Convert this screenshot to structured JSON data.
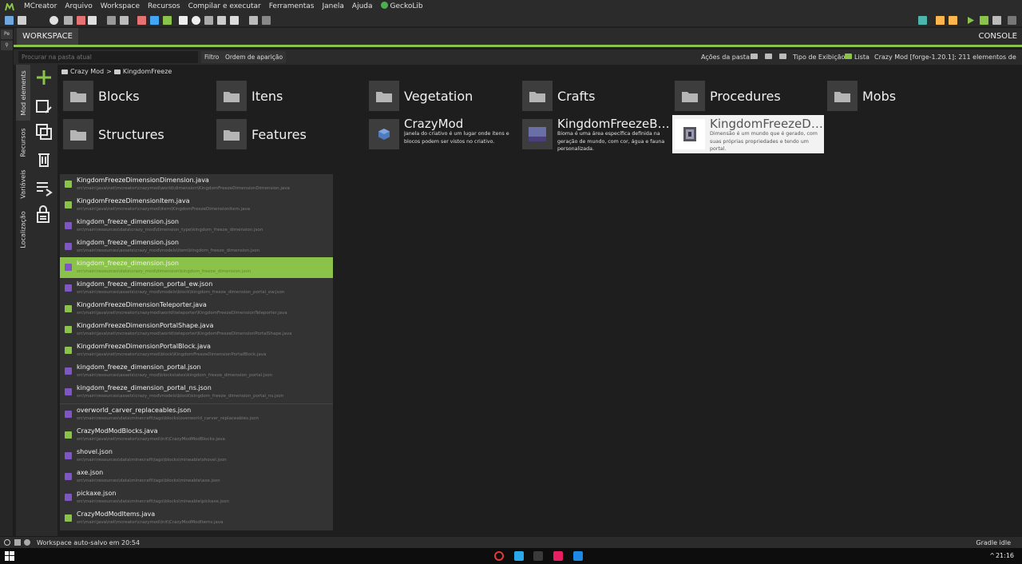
{
  "menubar": {
    "items": [
      "MCreator",
      "Arquivo",
      "Workspace",
      "Recursos",
      "Compilar e executar",
      "Ferramentas",
      "Janela",
      "Ajuda",
      "GeckoLib"
    ]
  },
  "tabs": {
    "workspace": "WORKSPACE",
    "console": "CONSOLE"
  },
  "search": {
    "placeholder": "Procurar na pasta atual",
    "filter_label": "Filtro",
    "order_label": "Ordem de aparição",
    "folder_actions_label": "Ações da pasta:",
    "view_type_label": "Tipo de Exibição:",
    "view_mode": "Lista",
    "workspace_info": "Crazy Mod [forge-1.20.1]: 211 elementos de mod"
  },
  "sidetabs": [
    "Mod elements",
    "Recursos",
    "Variáveis",
    "Localização"
  ],
  "breadcrumb": {
    "root": "Crazy Mod",
    "separator": ">",
    "current": "KingdomFreeze"
  },
  "folders": [
    "Blocks",
    "Itens",
    "Vegetation",
    "Crafts",
    "Procedures",
    "Mobs",
    "Structures",
    "Features"
  ],
  "elements": [
    {
      "title": "CrazyMod",
      "desc": "Janela do criativo é um lugar onde itens e blocos podem ser vistos no criativo."
    },
    {
      "title": "KingdomFreezeBio...",
      "desc": "Bioma é uma área específica definida na geração de mundo, com cor, água e fauna personalizada."
    },
    {
      "title": "KingdomFreezeDi...",
      "desc": "Dimensão é um mundo que é gerado, com suas próprias propriedades e tendo um portal."
    }
  ],
  "files": [
    {
      "name": "KingdomFreezeDimensionDimension.java",
      "path": "src\\main\\java\\net\\mcreator\\crazymod\\world\\dimension\\KingdomFreezeDimensionDimension.java",
      "type": "java"
    },
    {
      "name": "KingdomFreezeDimensionItem.java",
      "path": "src\\main\\java\\net\\mcreator\\crazymod\\item\\KingdomFreezeDimensionItem.java",
      "type": "java"
    },
    {
      "name": "kingdom_freeze_dimension.json",
      "path": "src\\main\\resources\\data\\crazy_mod\\dimension_type\\kingdom_freeze_dimension.json",
      "type": "json"
    },
    {
      "name": "kingdom_freeze_dimension.json",
      "path": "src\\main\\resources\\assets\\crazy_mod\\models\\item\\kingdom_freeze_dimension.json",
      "type": "json"
    },
    {
      "name": "kingdom_freeze_dimension.json",
      "path": "src\\main\\resources\\data\\crazy_mod\\dimension\\kingdom_freeze_dimension.json",
      "type": "json"
    },
    {
      "name": "kingdom_freeze_dimension_portal_ew.json",
      "path": "src\\main\\resources\\assets\\crazy_mod\\models\\block\\kingdom_freeze_dimension_portal_ew.json",
      "type": "json"
    },
    {
      "name": "KingdomFreezeDimensionTeleporter.java",
      "path": "src\\main\\java\\net\\mcreator\\crazymod\\world\\teleporter\\KingdomFreezeDimensionTeleporter.java",
      "type": "java"
    },
    {
      "name": "KingdomFreezeDimensionPortalShape.java",
      "path": "src\\main\\java\\net\\mcreator\\crazymod\\world\\teleporter\\KingdomFreezeDimensionPortalShape.java",
      "type": "java"
    },
    {
      "name": "KingdomFreezeDimensionPortalBlock.java",
      "path": "src\\main\\java\\net\\mcreator\\crazymod\\block\\KingdomFreezeDimensionPortalBlock.java",
      "type": "java"
    },
    {
      "name": "kingdom_freeze_dimension_portal.json",
      "path": "src\\main\\resources\\assets\\crazy_mod\\blockstates\\kingdom_freeze_dimension_portal.json",
      "type": "json"
    },
    {
      "name": "kingdom_freeze_dimension_portal_ns.json",
      "path": "src\\main\\resources\\assets\\crazy_mod\\models\\block\\kingdom_freeze_dimension_portal_ns.json",
      "type": "json"
    },
    {
      "name": "overworld_carver_replaceables.json",
      "path": "src\\main\\resources\\data\\minecraft\\tags\\blocks\\overworld_carver_replaceables.json",
      "type": "json"
    },
    {
      "name": "CrazyModModBlocks.java",
      "path": "src\\main\\java\\net\\mcreator\\crazymod\\init\\CrazyModModBlocks.java",
      "type": "java"
    },
    {
      "name": "shovel.json",
      "path": "src\\main\\resources\\data\\minecraft\\tags\\blocks\\mineable\\shovel.json",
      "type": "json"
    },
    {
      "name": "axe.json",
      "path": "src\\main\\resources\\data\\minecraft\\tags\\blocks\\mineable\\axe.json",
      "type": "json"
    },
    {
      "name": "pickaxe.json",
      "path": "src\\main\\resources\\data\\minecraft\\tags\\blocks\\mineable\\pickaxe.json",
      "type": "json"
    },
    {
      "name": "CrazyModModItems.java",
      "path": "src\\main\\java\\net\\mcreator\\crazymod\\init\\CrazyModModItems.java",
      "type": "java"
    }
  ],
  "status": {
    "text": "Workspace auto-salvo em 20:54",
    "right": "Gradle idle"
  },
  "taskbar": {
    "clock": "21:16"
  },
  "colors": {
    "accent": "#8bc34a",
    "json_icon": "#7e57c2",
    "background": "#1e1e1e"
  }
}
